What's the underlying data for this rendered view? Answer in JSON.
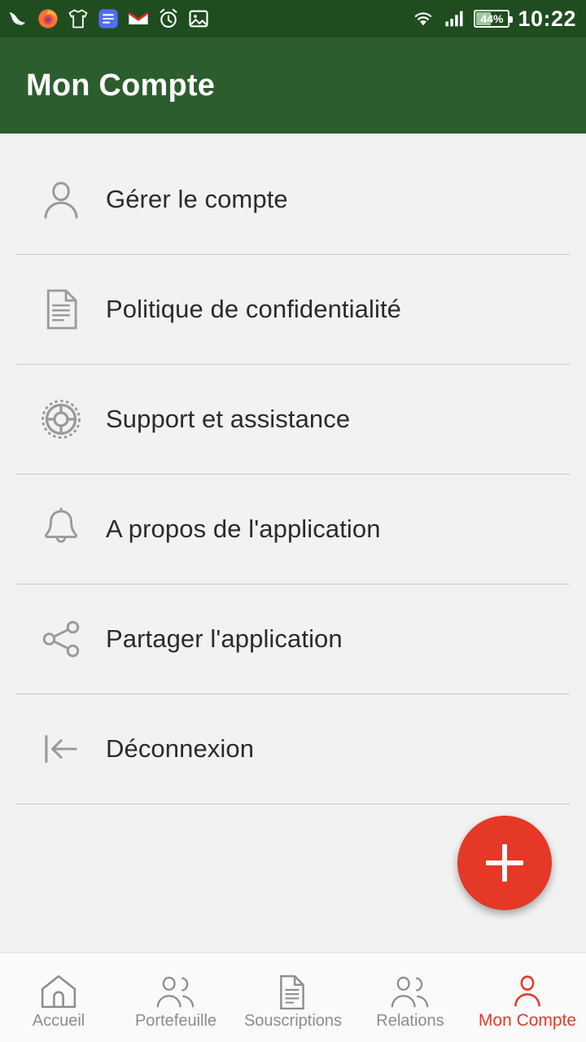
{
  "statusbar": {
    "time": "10:22",
    "battery_percent": "44%",
    "battery_level": 44,
    "left_icons": [
      {
        "name": "swallow-bird-app-icon"
      },
      {
        "name": "firefox-browser-icon"
      },
      {
        "name": "tshirt-app-icon"
      },
      {
        "name": "notes-app-icon"
      },
      {
        "name": "gmail-icon"
      },
      {
        "name": "alarm-clock-icon"
      },
      {
        "name": "gallery-image-icon"
      }
    ],
    "right_icons": [
      {
        "name": "wifi-icon"
      },
      {
        "name": "cellular-signal-icon"
      },
      {
        "name": "battery-icon"
      }
    ]
  },
  "appbar": {
    "title": "Mon Compte"
  },
  "menu": {
    "items": [
      {
        "label": "Gérer le compte",
        "icon": "person-icon"
      },
      {
        "label": "Politique de confidentialité",
        "icon": "document-icon"
      },
      {
        "label": "Support et assistance",
        "icon": "lifebuoy-icon"
      },
      {
        "label": "A propos de l'application",
        "icon": "bell-icon"
      },
      {
        "label": "Partager l'application",
        "icon": "share-icon"
      },
      {
        "label": "Déconnexion",
        "icon": "logout-arrow-icon"
      }
    ]
  },
  "fab": {
    "label": "+",
    "icon": "plus-icon",
    "color": "#e53826"
  },
  "bottomnav": {
    "active_index": 4,
    "items": [
      {
        "label": "Accueil",
        "icon": "home-icon"
      },
      {
        "label": "Portefeuille",
        "icon": "people-icon"
      },
      {
        "label": "Souscriptions",
        "icon": "document-icon"
      },
      {
        "label": "Relations",
        "icon": "people-icon"
      },
      {
        "label": "Mon Compte",
        "icon": "person-icon"
      }
    ]
  },
  "colors": {
    "statusbar": "#1f4d20",
    "appbar": "#2c5d2e",
    "accent": "#e53826",
    "background": "#f2f2f2"
  }
}
